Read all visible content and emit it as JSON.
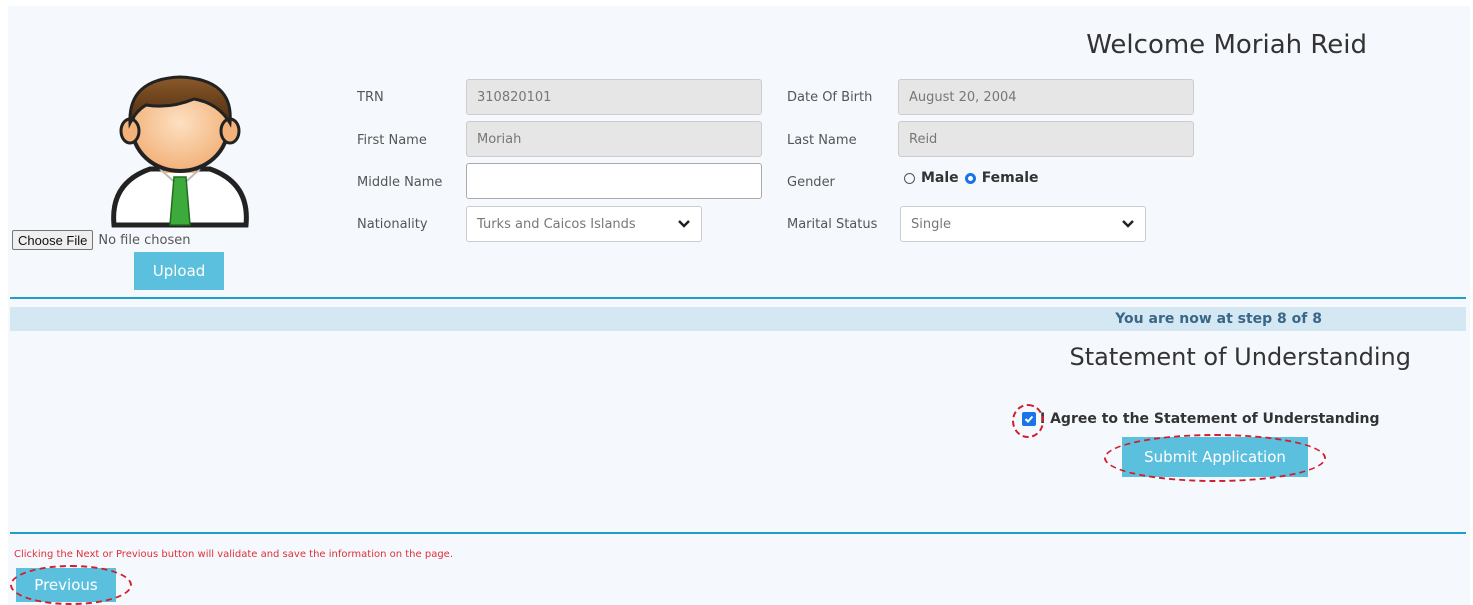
{
  "header": {
    "welcome": "Welcome Moriah Reid"
  },
  "photo": {
    "choose_file_label": "Choose File",
    "no_file_text": "No file chosen",
    "upload_label": "Upload"
  },
  "form": {
    "trn": {
      "label": "TRN",
      "value": "310820101"
    },
    "first_name": {
      "label": "First Name",
      "value": "Moriah"
    },
    "middle_name": {
      "label": "Middle Name",
      "value": ""
    },
    "nationality": {
      "label": "Nationality",
      "value": "Turks and Caicos Islands"
    },
    "dob": {
      "label": "Date Of Birth",
      "value": "August 20, 2004"
    },
    "last_name": {
      "label": "Last Name",
      "value": "Reid"
    },
    "gender": {
      "label": "Gender",
      "options": [
        "Male",
        "Female"
      ],
      "selected": "Female"
    },
    "marital_status": {
      "label": "Marital Status",
      "value": "Single"
    }
  },
  "steps": {
    "text": "You are now at step 8 of 8"
  },
  "statement": {
    "title": "Statement of Understanding",
    "agree_label": "I Agree to the Statement of Understanding",
    "agreed": true,
    "submit_label": "Submit Application"
  },
  "footer": {
    "note": "Clicking the Next or Previous button will validate and save the information on the page.",
    "previous_label": "Previous"
  },
  "colors": {
    "accent": "#5bc0de",
    "divider": "#1ca0c9",
    "step_bar": "#d4e8f4",
    "annotation": "#d11e2a",
    "note": "#e0303a"
  }
}
